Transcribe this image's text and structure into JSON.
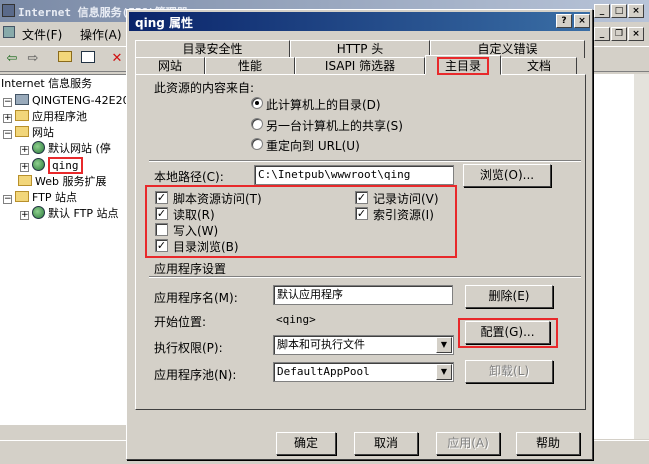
{
  "bg_window": {
    "title": "Internet 信息服务(IIS)管理器",
    "menu": [
      "文件(F)",
      "操作(A)"
    ],
    "tree": [
      {
        "label": "Internet 信息服务",
        "icon": "iis-root-icon"
      },
      {
        "label": "QINGTENG-42E207 (本",
        "icon": "computer-icon"
      },
      {
        "label": "应用程序池",
        "icon": "folder-icon"
      },
      {
        "label": "网站",
        "icon": "folder-icon"
      },
      {
        "label": "默认网站 (停",
        "icon": "website-icon"
      },
      {
        "label": "qing",
        "icon": "website-icon"
      },
      {
        "label": "Web 服务扩展",
        "icon": "folder-icon"
      },
      {
        "label": "FTP 站点",
        "icon": "folder-icon"
      },
      {
        "label": "默认 FTP 站点",
        "icon": "ftp-site-icon"
      }
    ]
  },
  "dialog": {
    "title": "qing 属性",
    "tabs_back": [
      "目录安全性",
      "HTTP 头",
      "自定义错误"
    ],
    "tabs_front": [
      "网站",
      "性能",
      "ISAPI 筛选器",
      "主目录",
      "文档"
    ],
    "active_tab": "主目录",
    "source_heading": "此资源的内容来自:",
    "source_options": [
      {
        "label": "此计算机上的目录(D)",
        "selected": true
      },
      {
        "label": "另一台计算机上的共享(S)",
        "selected": false
      },
      {
        "label": "重定向到 URL(U)",
        "selected": false
      }
    ],
    "local_path_label": "本地路径(C):",
    "local_path_value": "C:\\Inetpub\\wwwroot\\qing",
    "browse_label": "浏览(O)...",
    "permissions": {
      "script_access": {
        "label": "脚本资源访问(T)",
        "checked": true
      },
      "read": {
        "label": "读取(R)",
        "checked": true
      },
      "write": {
        "label": "写入(W)",
        "checked": false
      },
      "dir_browse": {
        "label": "目录浏览(B)",
        "checked": true
      },
      "log_visits": {
        "label": "记录访问(V)",
        "checked": true
      },
      "index_resource": {
        "label": "索引资源(I)",
        "checked": true
      }
    },
    "app_settings_heading": "应用程序设置",
    "app_name_label": "应用程序名(M):",
    "app_name_value": "默认应用程序",
    "remove_label": "删除(E)",
    "start_point_label": "开始位置:",
    "start_point_value": "<qing>",
    "config_label": "配置(G)...",
    "exec_perm_label": "执行权限(P):",
    "exec_perm_value": "脚本和可执行文件",
    "app_pool_label": "应用程序池(N):",
    "app_pool_value": "DefaultAppPool",
    "unload_label": "卸载(L)",
    "ok_label": "确定",
    "cancel_label": "取消",
    "apply_label": "应用(A)",
    "help_label": "帮助"
  },
  "colors": {
    "highlight_box": "#e8292b",
    "dialog_title_start": "#0a246a",
    "dialog_title_end": "#3a6ea5"
  }
}
